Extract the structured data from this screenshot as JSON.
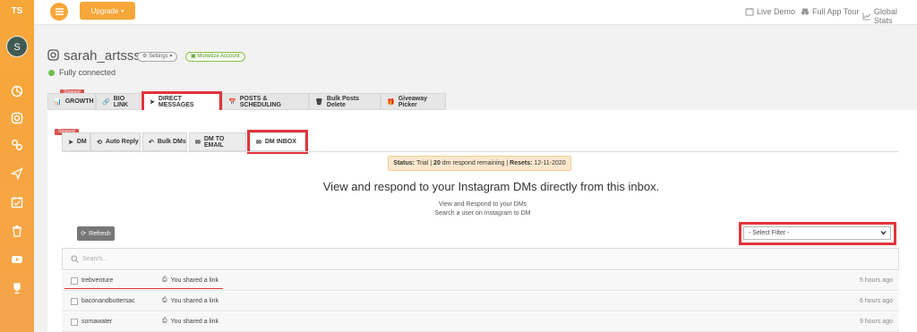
{
  "sidebar": {
    "logo": "TS",
    "avatar_initial": "S",
    "icons": [
      "dashboard-icon",
      "instagram-icon",
      "link-icon",
      "send-icon",
      "calendar-icon",
      "trash-icon",
      "youtube-icon",
      "trophy-icon"
    ]
  },
  "topbar": {
    "upgrade_label": "Upgrade",
    "links": [
      {
        "label": "Live Demo",
        "icon": "calendar-icon"
      },
      {
        "label": "Full App Tour",
        "icon": "binoculars-icon"
      },
      {
        "label": "Global Stats",
        "icon": "chart-icon"
      }
    ]
  },
  "profile": {
    "username": "sarah_artsss",
    "settings_label": "Settings",
    "monetize_label": "Monetize Account",
    "connection_status": "Fully connected"
  },
  "main_tabs": [
    {
      "label": "GROWTH",
      "badge": "Stopped"
    },
    {
      "label": "BIO LINK"
    },
    {
      "label": "DIRECT MESSAGES"
    },
    {
      "label": "POSTS & SCHEDULING"
    },
    {
      "label": "Bulk Posts Delete"
    },
    {
      "label": "Giveaway Picker"
    }
  ],
  "sub_tabs": [
    {
      "label": "DM",
      "badge": "Stopped"
    },
    {
      "label": "Auto Reply"
    },
    {
      "label": "Bulk DMs"
    },
    {
      "label": "DM TO EMAIL"
    },
    {
      "label": "DM INBOX"
    }
  ],
  "status_banner": {
    "status_label": "Status:",
    "status_value": "Trial",
    "remaining_count": "20",
    "remaining_text": "dm respond remaining",
    "resets_label": "Resets:",
    "resets_date": "12-11-2020"
  },
  "inbox": {
    "heading": "View and respond to your Instagram DMs directly from this inbox.",
    "line1": "View and Respond to your DMs",
    "line2": "Search a user on Instagram to DM",
    "refresh_label": "Refresh",
    "filter_selected": "- Select Filter -",
    "search_placeholder": "Search...",
    "rows": [
      {
        "user": "trebventure",
        "message": "You shared a link",
        "time": "5 hours ago"
      },
      {
        "user": "baconandbuttersac",
        "message": "You shared a link",
        "time": "6 hours ago"
      },
      {
        "user": "somawater",
        "message": "You shared a link",
        "time": "9 hours ago"
      }
    ]
  },
  "colors": {
    "accent": "#f7a739",
    "highlight": "#e0353b",
    "connected": "#6cc04a"
  }
}
